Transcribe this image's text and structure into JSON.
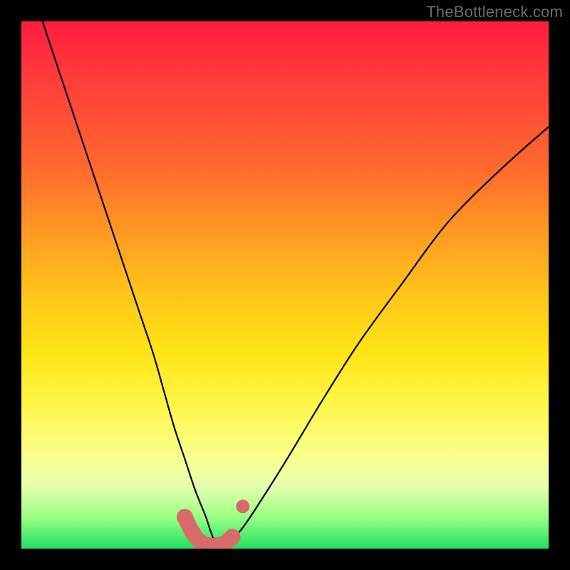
{
  "watermark": "TheBottleneck.com",
  "chart_data": {
    "type": "line",
    "title": "",
    "xlabel": "",
    "ylabel": "",
    "xlim": [
      0,
      100
    ],
    "ylim": [
      0,
      100
    ],
    "grid": false,
    "legend": false,
    "series": [
      {
        "name": "bottleneck-curve",
        "x": [
          4,
          7,
          10,
          13,
          16,
          19,
          22,
          25,
          27,
          29,
          31,
          33,
          35,
          36,
          37,
          39,
          42,
          46,
          51,
          57,
          64,
          72,
          81,
          91,
          100
        ],
        "values": [
          100,
          91,
          82,
          73,
          64,
          55,
          46,
          37,
          30,
          23,
          17,
          11,
          6,
          3,
          1,
          1,
          4,
          10,
          18,
          28,
          39,
          50,
          62,
          72,
          80
        ]
      }
    ],
    "markers": {
      "name": "highlighted-points",
      "color": "#d96a6a",
      "x": [
        31,
        32.5,
        34,
        35.5,
        37,
        38.5,
        40,
        42.0
      ],
      "values": [
        6.0,
        3.0,
        1.2,
        0.6,
        0.6,
        1.0,
        2.2,
        8.0
      ]
    },
    "background_gradient": {
      "direction": "vertical",
      "stops": [
        {
          "pos": 0.0,
          "color": "#ff1b3e"
        },
        {
          "pos": 0.28,
          "color": "#ff6a2e"
        },
        {
          "pos": 0.52,
          "color": "#ffc51a"
        },
        {
          "pos": 0.72,
          "color": "#fff544"
        },
        {
          "pos": 0.94,
          "color": "#9bff86"
        },
        {
          "pos": 1.0,
          "color": "#20e060"
        }
      ]
    }
  }
}
